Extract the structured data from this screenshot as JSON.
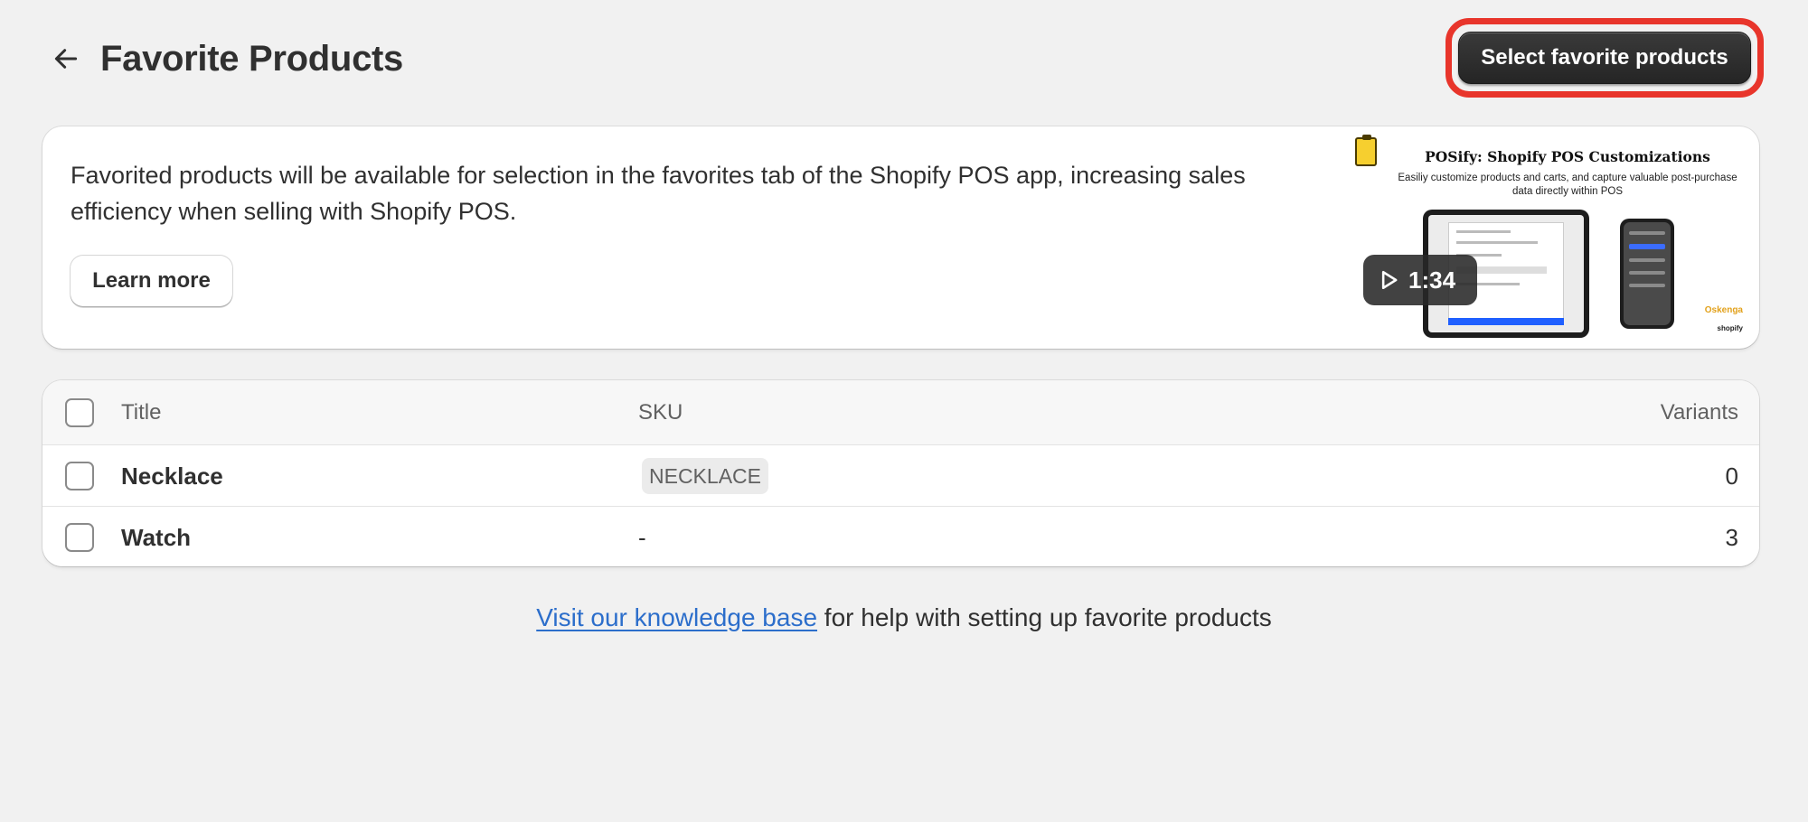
{
  "header": {
    "title": "Favorite Products",
    "primary_button": "Select favorite products"
  },
  "info_card": {
    "text": "Favorited products will be available for selection in the favorites tab of the Shopify POS app, increasing sales efficiency when selling with Shopify POS.",
    "learn_more": "Learn more",
    "video": {
      "title": "POSify: Shopify POS Customizations",
      "subtitle": "Easiliy customize products and carts, and capture valuable post-purchase data directly within POS",
      "duration": "1:34",
      "brand_small": "Oskenga",
      "platform_small": "shopify"
    }
  },
  "table": {
    "columns": {
      "title": "Title",
      "sku": "SKU",
      "variants": "Variants"
    },
    "rows": [
      {
        "title": "Necklace",
        "sku": "NECKLACE",
        "variants": "0"
      },
      {
        "title": "Watch",
        "sku": "-",
        "variants": "3"
      }
    ]
  },
  "footer": {
    "link_text": "Visit our knowledge base",
    "rest_text": " for help with setting up favorite products"
  },
  "colors": {
    "background": "#f1f1f1",
    "primary_button": "#303030",
    "highlight": "#e8352b",
    "link": "#2c6ecb"
  }
}
